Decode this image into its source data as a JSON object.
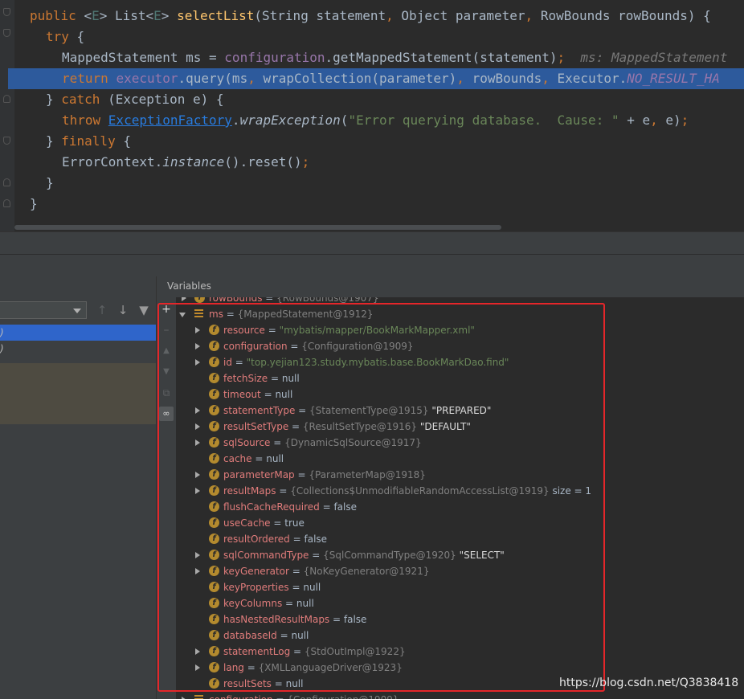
{
  "editor": {
    "lines": [
      {
        "segments": [
          {
            "t": "public ",
            "c": "kw"
          },
          {
            "t": "<",
            "c": ""
          },
          {
            "t": "E",
            "c": "gen"
          },
          {
            "t": "> List<",
            "c": ""
          },
          {
            "t": "E",
            "c": "gen"
          },
          {
            "t": "> ",
            "c": ""
          },
          {
            "t": "selectList",
            "c": "fn"
          },
          {
            "t": "(String statement",
            "c": ""
          },
          {
            "t": ", ",
            "c": "kw"
          },
          {
            "t": "Object parameter",
            "c": ""
          },
          {
            "t": ", ",
            "c": "kw"
          },
          {
            "t": "RowBounds rowBounds) {",
            "c": ""
          }
        ]
      },
      {
        "segments": [
          {
            "t": "try ",
            "c": "kw"
          },
          {
            "t": "{",
            "c": ""
          }
        ]
      },
      {
        "segments": [
          {
            "t": "MappedStatement ms = ",
            "c": ""
          },
          {
            "t": "configuration",
            "c": "field"
          },
          {
            "t": ".getMappedStatement(statement)",
            "c": ""
          },
          {
            "t": ";",
            "c": "kw"
          },
          {
            "t": "  ms: MappedStatement",
            "c": "hint"
          }
        ]
      },
      {
        "segments": [
          {
            "t": "return ",
            "c": "kw"
          },
          {
            "t": "executor",
            "c": "field"
          },
          {
            "t": ".query(ms",
            "c": ""
          },
          {
            "t": ", ",
            "c": "kw"
          },
          {
            "t": "wrapCollection(parameter)",
            "c": ""
          },
          {
            "t": ", ",
            "c": "kw"
          },
          {
            "t": "rowBounds",
            "c": ""
          },
          {
            "t": ", ",
            "c": "kw"
          },
          {
            "t": "Executor.",
            "c": ""
          },
          {
            "t": "NO_RESULT_HA",
            "c": "const"
          }
        ]
      },
      {
        "segments": [
          {
            "t": "} ",
            "c": ""
          },
          {
            "t": "catch ",
            "c": "kw"
          },
          {
            "t": "(Exception e) {",
            "c": ""
          }
        ]
      },
      {
        "segments": [
          {
            "t": "throw ",
            "c": "kw"
          },
          {
            "t": "ExceptionFactory",
            "c": "link"
          },
          {
            "t": ".",
            "c": ""
          },
          {
            "t": "wrapException",
            "c": "ital"
          },
          {
            "t": "(",
            "c": ""
          },
          {
            "t": "\"Error querying database.  Cause: \"",
            "c": "str"
          },
          {
            "t": " + e",
            "c": ""
          },
          {
            "t": ", ",
            "c": "kw"
          },
          {
            "t": "e)",
            "c": ""
          },
          {
            "t": ";",
            "c": "kw"
          }
        ]
      },
      {
        "segments": [
          {
            "t": "} ",
            "c": ""
          },
          {
            "t": "finally ",
            "c": "kw"
          },
          {
            "t": "{",
            "c": ""
          }
        ]
      },
      {
        "segments": [
          {
            "t": "ErrorContext.",
            "c": ""
          },
          {
            "t": "instance",
            "c": "ital"
          },
          {
            "t": "().reset()",
            "c": ""
          },
          {
            "t": ";",
            "c": "kw"
          }
        ]
      },
      {
        "segments": [
          {
            "t": "}",
            "c": ""
          }
        ]
      },
      {
        "segments": [
          {
            "t": "}",
            "c": ""
          }
        ]
      }
    ],
    "highlighted_line": 3
  },
  "variables_panel": {
    "title": "Variables",
    "top_cut_row": {
      "name": "rowBounds",
      "ref": "{RowBounds@1907}"
    },
    "root": {
      "name": "ms",
      "ref": "{MappedStatement@1912}"
    },
    "fields": [
      {
        "name": "resource",
        "ref": "",
        "value": "\"mybatis/mapper/BookMarkMapper.xml\"",
        "kind": "str",
        "expandable": true
      },
      {
        "name": "configuration",
        "ref": "{Configuration@1909}",
        "value": "",
        "kind": "",
        "expandable": true
      },
      {
        "name": "id",
        "ref": "",
        "value": "\"top.yejian123.study.mybatis.base.BookMarkDao.find\"",
        "kind": "str",
        "expandable": true
      },
      {
        "name": "fetchSize",
        "ref": "",
        "value": "null",
        "kind": "val",
        "expandable": false
      },
      {
        "name": "timeout",
        "ref": "",
        "value": "null",
        "kind": "val",
        "expandable": false
      },
      {
        "name": "statementType",
        "ref": "{StatementType@1915}",
        "value": "\"PREPARED\"",
        "kind": "q",
        "expandable": true
      },
      {
        "name": "resultSetType",
        "ref": "{ResultSetType@1916}",
        "value": "\"DEFAULT\"",
        "kind": "q",
        "expandable": true
      },
      {
        "name": "sqlSource",
        "ref": "{DynamicSqlSource@1917}",
        "value": "",
        "kind": "",
        "expandable": true
      },
      {
        "name": "cache",
        "ref": "",
        "value": "null",
        "kind": "val",
        "expandable": false
      },
      {
        "name": "parameterMap",
        "ref": "{ParameterMap@1918}",
        "value": "",
        "kind": "",
        "expandable": true
      },
      {
        "name": "resultMaps",
        "ref": "{Collections$UnmodifiableRandomAccessList@1919}",
        "value": " size = 1",
        "kind": "val",
        "expandable": true
      },
      {
        "name": "flushCacheRequired",
        "ref": "",
        "value": "false",
        "kind": "val",
        "expandable": false
      },
      {
        "name": "useCache",
        "ref": "",
        "value": "true",
        "kind": "val",
        "expandable": false
      },
      {
        "name": "resultOrdered",
        "ref": "",
        "value": "false",
        "kind": "val",
        "expandable": false
      },
      {
        "name": "sqlCommandType",
        "ref": "{SqlCommandType@1920}",
        "value": "\"SELECT\"",
        "kind": "q",
        "expandable": true
      },
      {
        "name": "keyGenerator",
        "ref": "{NoKeyGenerator@1921}",
        "value": "",
        "kind": "",
        "expandable": true
      },
      {
        "name": "keyProperties",
        "ref": "",
        "value": "null",
        "kind": "val",
        "expandable": false
      },
      {
        "name": "keyColumns",
        "ref": "",
        "value": "null",
        "kind": "val",
        "expandable": false
      },
      {
        "name": "hasNestedResultMaps",
        "ref": "",
        "value": "false",
        "kind": "val",
        "expandable": false
      },
      {
        "name": "databaseId",
        "ref": "",
        "value": "null",
        "kind": "val",
        "expandable": false
      },
      {
        "name": "statementLog",
        "ref": "{StdOutImpl@1922}",
        "value": "",
        "kind": "",
        "expandable": true
      },
      {
        "name": "lang",
        "ref": "{XMLLanguageDriver@1923}",
        "value": "",
        "kind": "",
        "expandable": true
      },
      {
        "name": "resultSets",
        "ref": "",
        "value": "null",
        "kind": "val",
        "expandable": false
      }
    ],
    "bottom_cut_row": {
      "name": "configuration",
      "ref": "{Configuration@1909}"
    }
  },
  "frames_panel": {
    "frames": [
      ")",
      ")"
    ]
  },
  "watermark": "https://blog.csdn.net/Q3838418",
  "colors": {
    "highlight_line": "#2d5a9c",
    "selected_frame": "#2f65ca",
    "red_box": "#e5262a",
    "field_icon": "#b38a2e"
  }
}
